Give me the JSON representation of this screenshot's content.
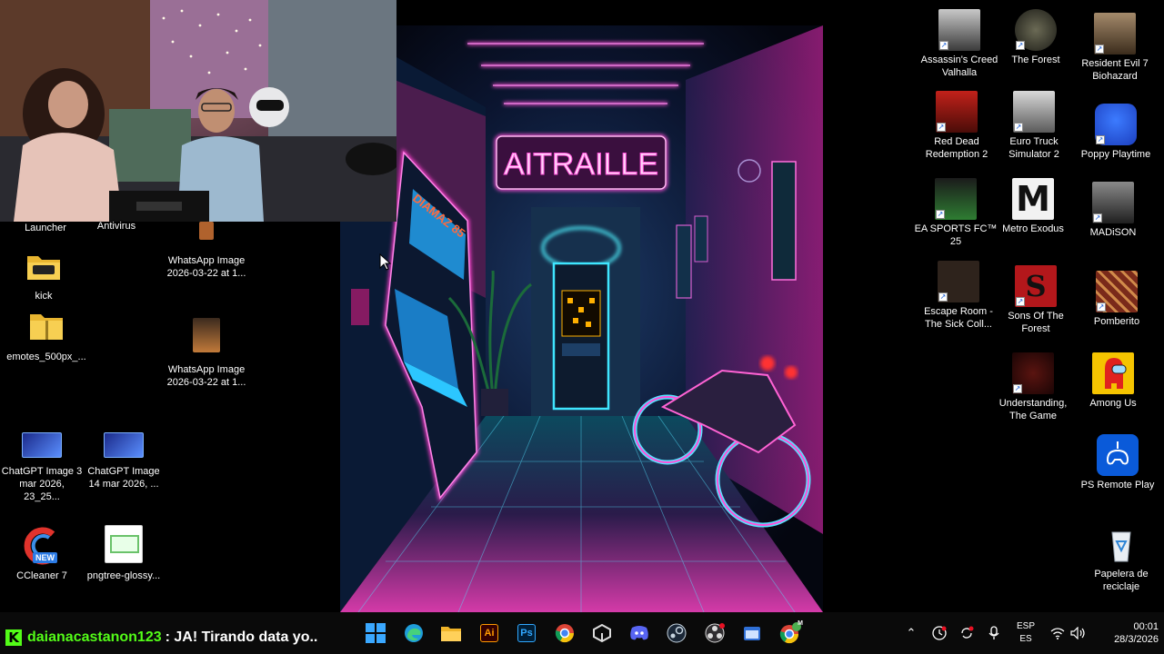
{
  "desktop": {
    "left_icons": [
      {
        "label": "Launcher",
        "icon": "launcher-icon"
      },
      {
        "label": "Antivirus",
        "icon": "antivirus-icon"
      },
      {
        "label": "kick",
        "icon": "folder-icon"
      },
      {
        "label": "emotes_500px_...",
        "icon": "zip-folder-icon"
      },
      {
        "label": "WhatsApp Image 2026-03-22 at 1...",
        "icon": "image-icon"
      },
      {
        "label": "WhatsApp Image 2026-03-22 at 1...",
        "icon": "image-icon"
      },
      {
        "label": "ChatGPT Image 3 mar 2026, 23_25...",
        "icon": "image-icon"
      },
      {
        "label": "ChatGPT Image 14 mar 2026, ...",
        "icon": "image-icon"
      },
      {
        "label": "CCleaner 7",
        "icon": "ccleaner-icon",
        "badge": "NEW"
      },
      {
        "label": "pngtree-glossy...",
        "icon": "image-icon"
      }
    ],
    "right_icons": [
      {
        "label": "Assassin's Creed Valhalla",
        "icon": "game-icon"
      },
      {
        "label": "The Forest",
        "icon": "game-icon"
      },
      {
        "label": "Resident Evil 7 Biohazard",
        "icon": "game-icon"
      },
      {
        "label": "Red Dead Redemption 2",
        "icon": "game-icon"
      },
      {
        "label": "Euro Truck Simulator 2",
        "icon": "game-icon"
      },
      {
        "label": "Poppy Playtime",
        "icon": "game-icon"
      },
      {
        "label": "EA SPORTS FC™ 25",
        "icon": "game-icon"
      },
      {
        "label": "Metro Exodus",
        "icon": "game-icon",
        "mark": "M"
      },
      {
        "label": "MADiSON",
        "icon": "game-icon"
      },
      {
        "label": "Escape Room - The Sick Coll...",
        "icon": "game-icon"
      },
      {
        "label": "Sons Of The Forest",
        "icon": "game-icon",
        "mark": "S"
      },
      {
        "label": "Pomberito",
        "icon": "game-icon"
      },
      {
        "label": "Understanding, The Game",
        "icon": "game-icon"
      },
      {
        "label": "Among Us",
        "icon": "game-icon"
      },
      {
        "label": "PS Remote Play",
        "icon": "ps-remote-play-icon"
      },
      {
        "label": "Papelera de reciclaje",
        "icon": "recycle-bin-icon"
      }
    ]
  },
  "wallpaper": {
    "neon_sign": "AITRAILLE",
    "arcade_marquee": "DIAMAZ 85"
  },
  "stream_chat": {
    "logo_letter": "K",
    "username": "daianacastanon123",
    "message": ": JA! Tirando data yo.."
  },
  "taskbar": {
    "apps": [
      {
        "name": "windows-start",
        "label": ""
      },
      {
        "name": "edge",
        "label": ""
      },
      {
        "name": "file-explorer",
        "label": ""
      },
      {
        "name": "illustrator",
        "label": "Ai"
      },
      {
        "name": "photoshop",
        "label": "Ps"
      },
      {
        "name": "chrome",
        "label": ""
      },
      {
        "name": "unity",
        "label": ""
      },
      {
        "name": "discord",
        "label": ""
      },
      {
        "name": "steam",
        "label": ""
      },
      {
        "name": "obs",
        "label": ""
      },
      {
        "name": "app-window",
        "label": ""
      },
      {
        "name": "chrome-profile",
        "label": "M"
      }
    ],
    "language": {
      "line1": "ESP",
      "line2": "ES"
    },
    "time": "00:01",
    "date": "28/3/2026"
  }
}
